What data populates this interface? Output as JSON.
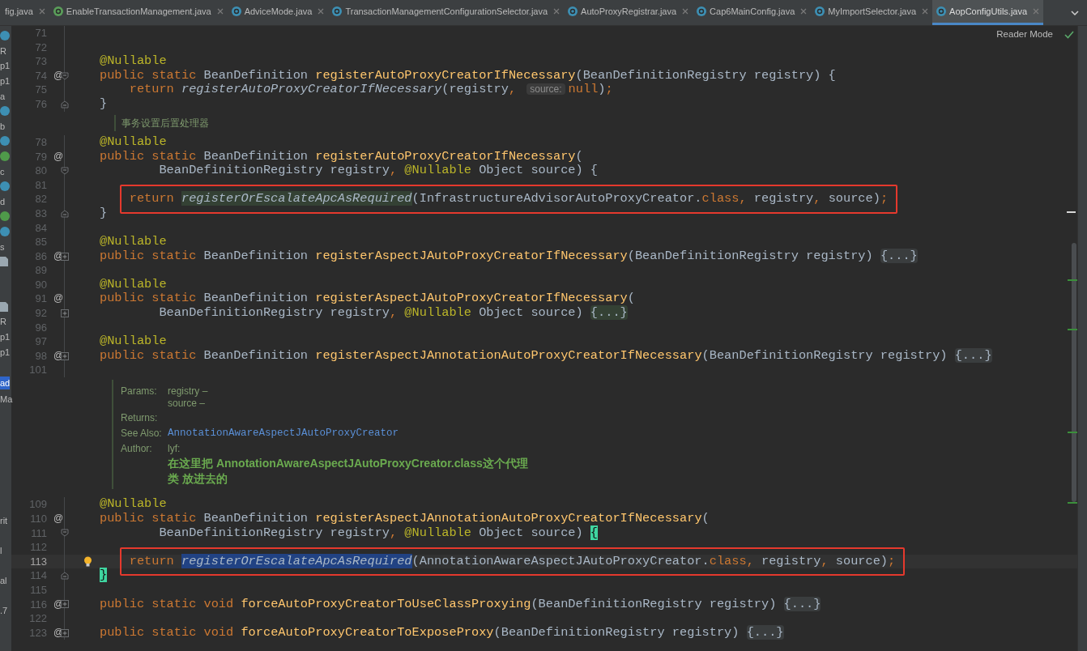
{
  "tabs": [
    {
      "label": "fig.java",
      "kind": "plain",
      "selected": false
    },
    {
      "label": "EnableTransactionManagement.java",
      "kind": "annotation",
      "selected": false
    },
    {
      "label": "AdviceMode.java",
      "kind": "enum",
      "selected": false
    },
    {
      "label": "TransactionManagementConfigurationSelector.java",
      "kind": "class",
      "selected": false
    },
    {
      "label": "AutoProxyRegistrar.java",
      "kind": "class",
      "selected": false
    },
    {
      "label": "Cap6MainConfig.java",
      "kind": "class",
      "selected": false
    },
    {
      "label": "MyImportSelector.java",
      "kind": "class",
      "selected": false
    },
    {
      "label": "AopConfigUtils.java",
      "kind": "class",
      "selected": true
    }
  ],
  "reader_mode": "Reader Mode",
  "sidebar": {
    "groups": [
      [
        {
          "kind": "class-icon"
        },
        {
          "kind": "text",
          "text": "R",
          "selected": false
        },
        {
          "kind": "text",
          "text": "p1",
          "selected": false
        },
        {
          "kind": "text",
          "text": "p1",
          "selected": false
        },
        {
          "kind": "text",
          "text": "a",
          "selected": false
        },
        {
          "kind": "class-icon"
        },
        {
          "kind": "text",
          "text": "b",
          "selected": false
        },
        {
          "kind": "class-icon"
        },
        {
          "kind": "green-icon"
        },
        {
          "kind": "text",
          "text": "c",
          "selected": false
        },
        {
          "kind": "class-icon"
        },
        {
          "kind": "text",
          "text": "d",
          "selected": false
        },
        {
          "kind": "green-icon"
        },
        {
          "kind": "class-icon"
        },
        {
          "kind": "text",
          "text": "s",
          "selected": false
        },
        {
          "kind": "file-icon"
        }
      ],
      [
        {
          "kind": "file-icon"
        },
        {
          "kind": "text",
          "text": "R",
          "selected": false
        },
        {
          "kind": "text",
          "text": "p1",
          "selected": false
        },
        {
          "kind": "text",
          "text": "p1",
          "selected": false
        }
      ],
      [
        {
          "kind": "text",
          "text": "ad",
          "selected": true
        },
        {
          "kind": "text",
          "text": "Ma",
          "selected": false
        }
      ],
      [
        {
          "kind": "text",
          "text": "rit",
          "selected": false
        },
        {
          "kind": "text",
          "text": "l",
          "selected": false
        },
        {
          "kind": "text",
          "text": "al",
          "selected": false
        },
        {
          "kind": "text",
          "text": ".7",
          "selected": false
        }
      ]
    ]
  },
  "lines": [
    {
      "kind": "code",
      "num": "71",
      "boxed": false,
      "current": false
    },
    {
      "kind": "code",
      "num": "72",
      "boxed": false,
      "current": false
    },
    {
      "kind": "code",
      "num": "73",
      "boxed": false,
      "current": false,
      "tokens": [
        {
          "kind": "ann",
          "text": "@Nullable"
        }
      ]
    },
    {
      "kind": "code",
      "num": "74",
      "marker": "@",
      "fold": {
        "kind": "open"
      },
      "boxed": false,
      "current": false,
      "tokens": [
        {
          "kind": "kw",
          "text": "public static "
        },
        {
          "kind": "text",
          "text": "BeanDefinition "
        },
        {
          "kind": "decl",
          "text": "registerAutoProxyCreatorIfNecessary"
        },
        {
          "kind": "text",
          "text": "(BeanDefinitionRegistry registry) {"
        }
      ]
    },
    {
      "kind": "body",
      "num": "75",
      "boxed": false,
      "current": false,
      "tokens": [
        {
          "kind": "kw",
          "text": "return "
        },
        {
          "kind": "call",
          "text": "registerAutoProxyCreatorIfNecessary"
        },
        {
          "kind": "text",
          "text": "(registry"
        },
        {
          "kind": "kw",
          "text": ", "
        },
        {
          "kind": "hint",
          "text": "source:"
        },
        {
          "kind": "kw",
          "text": "null"
        },
        {
          "kind": "text",
          "text": ")"
        },
        {
          "kind": "kw",
          "text": ";"
        }
      ]
    },
    {
      "kind": "code",
      "num": "76",
      "fold": {
        "kind": "close"
      },
      "boxed": false,
      "current": false,
      "tokens": [
        {
          "kind": "text",
          "text": "}"
        }
      ]
    },
    {
      "kind": "doc",
      "text": "事务设置后置处理器"
    },
    {
      "kind": "code",
      "num": "78",
      "boxed": false,
      "current": false,
      "tokens": [
        {
          "kind": "ann",
          "text": "@Nullable"
        }
      ]
    },
    {
      "kind": "code",
      "num": "79",
      "marker": "@",
      "boxed": false,
      "current": false,
      "tokens": [
        {
          "kind": "kw",
          "text": "public static "
        },
        {
          "kind": "text",
          "text": "BeanDefinition "
        },
        {
          "kind": "decl",
          "text": "registerAutoProxyCreatorIfNecessary"
        },
        {
          "kind": "text",
          "text": "("
        }
      ]
    },
    {
      "kind": "cont",
      "num": "80",
      "fold": {
        "kind": "open"
      },
      "boxed": false,
      "current": false,
      "tokens": [
        {
          "kind": "text",
          "text": "BeanDefinitionRegistry registry"
        },
        {
          "kind": "kw",
          "text": ", "
        },
        {
          "kind": "ann",
          "text": "@Nullable "
        },
        {
          "kind": "text",
          "text": "Object source) {"
        }
      ]
    },
    {
      "kind": "code",
      "num": "81",
      "boxed": false,
      "current": false
    },
    {
      "kind": "body",
      "num": "82",
      "boxed": true,
      "current": false,
      "tokens": [
        {
          "kind": "kw",
          "text": "return "
        },
        {
          "kind": "call-usage",
          "text": "registerOrEscalateApcAsRequired"
        },
        {
          "kind": "text",
          "text": "(InfrastructureAdvisorAutoProxyCreator."
        },
        {
          "kind": "kw",
          "text": "class"
        },
        {
          "kind": "kw",
          "text": ", "
        },
        {
          "kind": "text",
          "text": "registry"
        },
        {
          "kind": "kw",
          "text": ", "
        },
        {
          "kind": "text",
          "text": "source)"
        },
        {
          "kind": "kw",
          "text": ";"
        }
      ]
    },
    {
      "kind": "code",
      "num": "83",
      "fold": {
        "kind": "close"
      },
      "boxed": false,
      "current": false,
      "tokens": [
        {
          "kind": "text",
          "text": "}"
        }
      ]
    },
    {
      "kind": "code",
      "num": "84",
      "boxed": false,
      "current": false
    },
    {
      "kind": "code",
      "num": "85",
      "boxed": false,
      "current": false,
      "tokens": [
        {
          "kind": "ann",
          "text": "@Nullable"
        }
      ]
    },
    {
      "kind": "code",
      "num": "86",
      "marker": "@",
      "fold": {
        "kind": "collapsed"
      },
      "boxed": false,
      "current": false,
      "tokens": [
        {
          "kind": "kw",
          "text": "public static "
        },
        {
          "kind": "text",
          "text": "BeanDefinition "
        },
        {
          "kind": "decl",
          "text": "registerAspectJAutoProxyCreatorIfNecessary"
        },
        {
          "kind": "text",
          "text": "(BeanDefinitionRegistry registry) "
        },
        {
          "kind": "fold",
          "text": "{...}"
        }
      ]
    },
    {
      "kind": "code",
      "num": "89",
      "boxed": false,
      "current": false
    },
    {
      "kind": "code",
      "num": "90",
      "boxed": false,
      "current": false,
      "tokens": [
        {
          "kind": "ann",
          "text": "@Nullable"
        }
      ]
    },
    {
      "kind": "code",
      "num": "91",
      "marker": "@",
      "boxed": false,
      "current": false,
      "tokens": [
        {
          "kind": "kw",
          "text": "public static "
        },
        {
          "kind": "text",
          "text": "BeanDefinition "
        },
        {
          "kind": "decl",
          "text": "registerAspectJAutoProxyCreatorIfNecessary"
        },
        {
          "kind": "text",
          "text": "("
        }
      ]
    },
    {
      "kind": "cont",
      "num": "92",
      "fold": {
        "kind": "collapsed"
      },
      "boxed": false,
      "current": false,
      "tokens": [
        {
          "kind": "text",
          "text": "BeanDefinitionRegistry registry"
        },
        {
          "kind": "kw",
          "text": ", "
        },
        {
          "kind": "ann",
          "text": "@Nullable "
        },
        {
          "kind": "text",
          "text": "Object source) "
        },
        {
          "kind": "fold-match",
          "text": "{...}"
        }
      ]
    },
    {
      "kind": "code",
      "num": "96",
      "boxed": false,
      "current": false
    },
    {
      "kind": "code",
      "num": "97",
      "boxed": false,
      "current": false,
      "tokens": [
        {
          "kind": "ann",
          "text": "@Nullable"
        }
      ]
    },
    {
      "kind": "code",
      "num": "98",
      "marker": "@",
      "fold": {
        "kind": "collapsed"
      },
      "boxed": false,
      "current": false,
      "tokens": [
        {
          "kind": "kw",
          "text": "public static "
        },
        {
          "kind": "text",
          "text": "BeanDefinition "
        },
        {
          "kind": "decl",
          "text": "registerAspectJAnnotationAutoProxyCreatorIfNecessary"
        },
        {
          "kind": "text",
          "text": "(BeanDefinitionRegistry registry) "
        },
        {
          "kind": "fold",
          "text": "{...}"
        }
      ]
    },
    {
      "kind": "code",
      "num": "101",
      "boxed": false,
      "current": false
    },
    {
      "kind": "javadoc",
      "params_label": "Params:",
      "params": [
        "registry –",
        "source –"
      ],
      "returns_label": "Returns:",
      "see_also_label": "See Also:",
      "see_also": "AnnotationAwareAspectJAutoProxyCreator",
      "author_label": "Author:",
      "author": "lyf:",
      "note": "在这里把 AnnotationAwareAspectJAutoProxyCreator.class这个代理类 放进去的"
    },
    {
      "kind": "code",
      "num": "109",
      "boxed": false,
      "current": false,
      "tokens": [
        {
          "kind": "ann",
          "text": "@Nullable"
        }
      ]
    },
    {
      "kind": "code",
      "num": "110",
      "marker": "@",
      "boxed": false,
      "current": false,
      "tokens": [
        {
          "kind": "kw",
          "text": "public static "
        },
        {
          "kind": "text",
          "text": "BeanDefinition "
        },
        {
          "kind": "decl",
          "text": "registerAspectJAnnotationAutoProxyCreatorIfNecessary"
        },
        {
          "kind": "text",
          "text": "("
        }
      ]
    },
    {
      "kind": "cont",
      "num": "111",
      "fold": {
        "kind": "open"
      },
      "boxed": false,
      "current": false,
      "tokens": [
        {
          "kind": "text",
          "text": "BeanDefinitionRegistry registry"
        },
        {
          "kind": "kw",
          "text": ", "
        },
        {
          "kind": "ann",
          "text": "@Nullable "
        },
        {
          "kind": "text",
          "text": "Object source) "
        },
        {
          "kind": "brace",
          "text": "{"
        }
      ]
    },
    {
      "kind": "code",
      "num": "112",
      "boxed": false,
      "current": false
    },
    {
      "kind": "body",
      "num": "113",
      "bulb": true,
      "boxed": true,
      "current": true,
      "tokens": [
        {
          "kind": "kw",
          "text": "return "
        },
        {
          "kind": "call-selected",
          "text": "registerOrEscalateApcAsRequired"
        },
        {
          "kind": "text",
          "text": "(AnnotationAwareAspectJAutoProxyCreator."
        },
        {
          "kind": "kw",
          "text": "class"
        },
        {
          "kind": "kw",
          "text": ", "
        },
        {
          "kind": "text",
          "text": "registry"
        },
        {
          "kind": "kw",
          "text": ", "
        },
        {
          "kind": "text",
          "text": "source)"
        },
        {
          "kind": "kw",
          "text": ";"
        }
      ]
    },
    {
      "kind": "code",
      "num": "114",
      "fold": {
        "kind": "close"
      },
      "boxed": false,
      "current": false,
      "tokens": [
        {
          "kind": "brace",
          "text": "}"
        }
      ]
    },
    {
      "kind": "code",
      "num": "115",
      "boxed": false,
      "current": false
    },
    {
      "kind": "code",
      "num": "116",
      "marker": "@",
      "fold": {
        "kind": "collapsed"
      },
      "boxed": false,
      "current": false,
      "tokens": [
        {
          "kind": "kw",
          "text": "public static void "
        },
        {
          "kind": "decl",
          "text": "forceAutoProxyCreatorToUseClassProxying"
        },
        {
          "kind": "text",
          "text": "(BeanDefinitionRegistry registry) "
        },
        {
          "kind": "fold",
          "text": "{...}"
        }
      ]
    },
    {
      "kind": "code",
      "num": "122",
      "boxed": false,
      "current": false
    },
    {
      "kind": "code",
      "num": "123",
      "marker": "@",
      "fold": {
        "kind": "collapsed"
      },
      "boxed": false,
      "current": false,
      "tokens": [
        {
          "kind": "kw",
          "text": "public static void "
        },
        {
          "kind": "decl",
          "text": "forceAutoProxyCreatorToExposeProxy"
        },
        {
          "kind": "text",
          "text": "(BeanDefinitionRegistry registry) "
        },
        {
          "kind": "fold",
          "text": "{...}"
        }
      ]
    }
  ]
}
